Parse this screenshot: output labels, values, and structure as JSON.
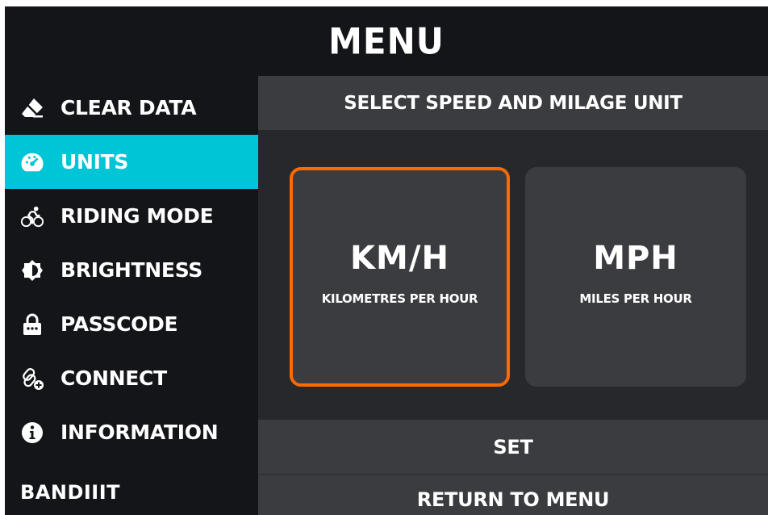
{
  "header": {
    "title": "MENU"
  },
  "sidebar": {
    "items": [
      {
        "label": "CLEAR DATA",
        "icon": "eraser-icon"
      },
      {
        "label": "UNITS",
        "icon": "speedometer-icon",
        "active": true
      },
      {
        "label": "RIDING MODE",
        "icon": "cyclist-icon"
      },
      {
        "label": "BRIGHTNESS",
        "icon": "brightness-icon"
      },
      {
        "label": "PASSCODE",
        "icon": "lock-icon"
      },
      {
        "label": "CONNECT",
        "icon": "link-plus-icon"
      },
      {
        "label": "INFORMATION",
        "icon": "info-icon"
      }
    ],
    "brand": "BANDIIIT"
  },
  "content": {
    "title": "SELECT SPEED AND MILAGE UNIT",
    "options": [
      {
        "main": "KM/H",
        "sub": "KILOMETRES PER HOUR",
        "selected": true
      },
      {
        "main": "MPH",
        "sub": "MILES PER HOUR",
        "selected": false
      }
    ],
    "set_label": "SET",
    "return_label": "RETURN TO MENU"
  },
  "colors": {
    "background": "#141518",
    "accent_active": "#00c5d6",
    "selected_border": "#ff6a00",
    "panel": "#3b3c3f"
  }
}
